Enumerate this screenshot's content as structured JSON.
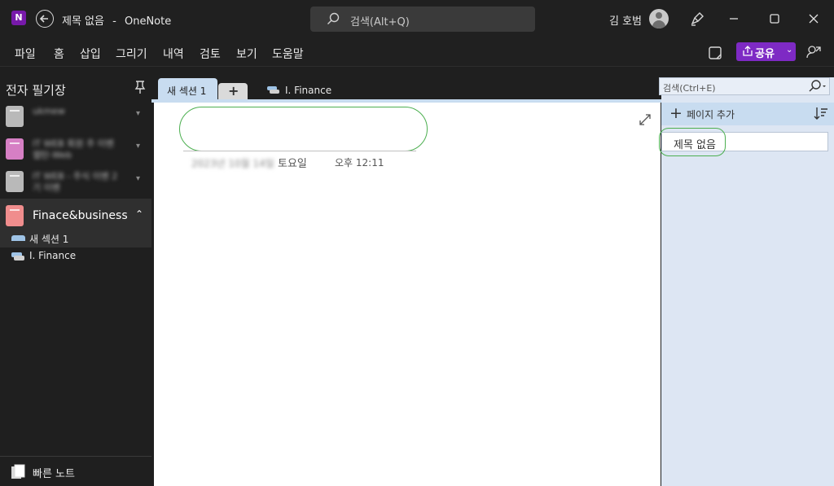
{
  "titlebar": {
    "app_icon_letter": "N",
    "doc_title": "제목 없음",
    "separator": "-",
    "app_name": "OneNote",
    "search_placeholder": "검색(Alt+Q)",
    "user_name": "김 호범"
  },
  "menu": {
    "items": [
      "파일",
      "홈",
      "삽입",
      "그리기",
      "내역",
      "검토",
      "보기",
      "도움말"
    ],
    "share_label": "공유",
    "share_color": "#7e2ac4"
  },
  "sidebar": {
    "title": "전자 필기장",
    "notebooks": [
      {
        "label": "ukmew",
        "color": "#b9b9b9"
      },
      {
        "label": "IT WEB 회원 주 이벤 웹탄-Web",
        "color": "#d67fc4"
      },
      {
        "label": "IT WEB - 주식 이벤 2기 이벤",
        "color": "#b9b9b9"
      }
    ],
    "active_notebook": {
      "label": "Finace&business",
      "color": "#f08d8d"
    },
    "sections": [
      {
        "label": "새 섹션 1",
        "color": "#9ec3e6"
      },
      {
        "label": "I. Finance",
        "color": "#9ec3e6"
      }
    ],
    "quick_notes": "빠른 노트"
  },
  "tabs": {
    "active": "새 섹션 1",
    "add": "+",
    "other": "I. Finance"
  },
  "page": {
    "date_blurred": "2023년 10월 14일",
    "date_day": "토요일",
    "time": "오후 12:11"
  },
  "pagepanel": {
    "search_placeholder": "검색(Ctrl+E)",
    "add_page_label": "페이지 추가",
    "pages": [
      "제목 없음"
    ]
  },
  "colors": {
    "highlight_oval": "#4caf50",
    "accent_tab": "#c8dcf0"
  }
}
